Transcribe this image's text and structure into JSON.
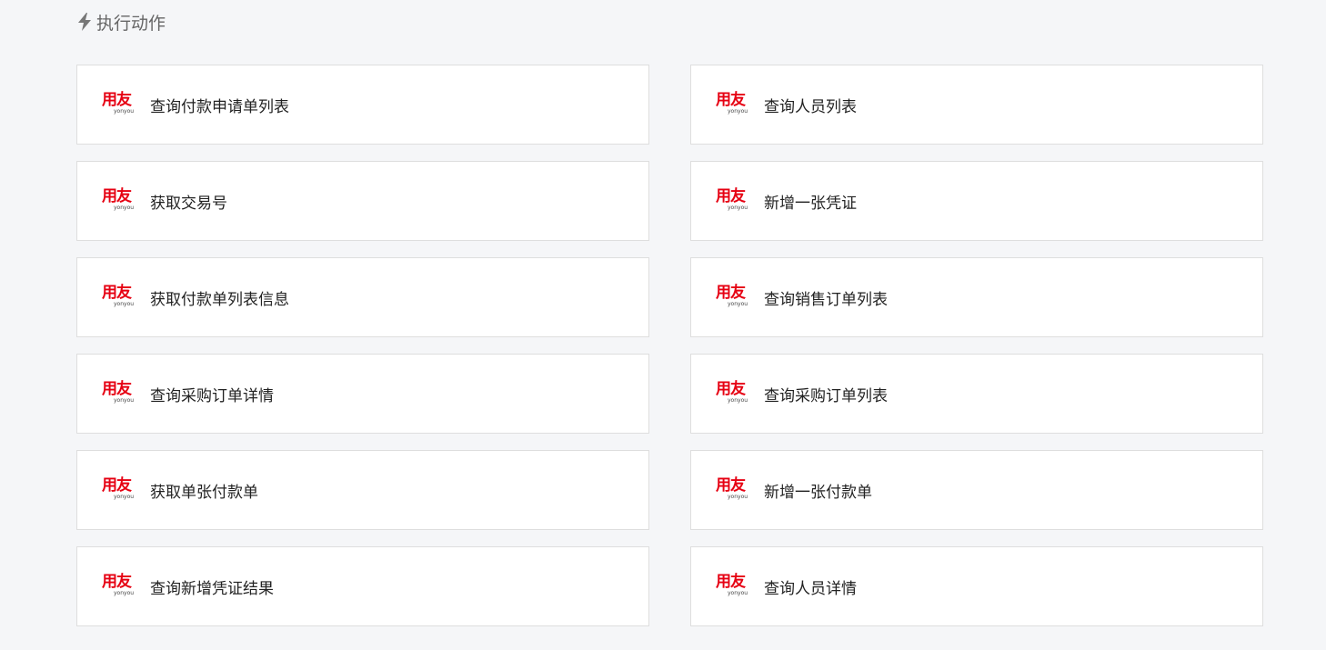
{
  "header": {
    "icon": "lightning-icon",
    "title": "执行动作"
  },
  "brand": {
    "logo_text": "用友",
    "logo_subtext": "yonyou",
    "color": "#e60012"
  },
  "actions": [
    {
      "label": "查询付款申请单列表"
    },
    {
      "label": "查询人员列表"
    },
    {
      "label": "获取交易号"
    },
    {
      "label": "新增一张凭证"
    },
    {
      "label": "获取付款单列表信息"
    },
    {
      "label": "查询销售订单列表"
    },
    {
      "label": "查询采购订单详情"
    },
    {
      "label": "查询采购订单列表"
    },
    {
      "label": "获取单张付款单"
    },
    {
      "label": "新增一张付款单"
    },
    {
      "label": "查询新增凭证结果"
    },
    {
      "label": "查询人员详情"
    }
  ]
}
